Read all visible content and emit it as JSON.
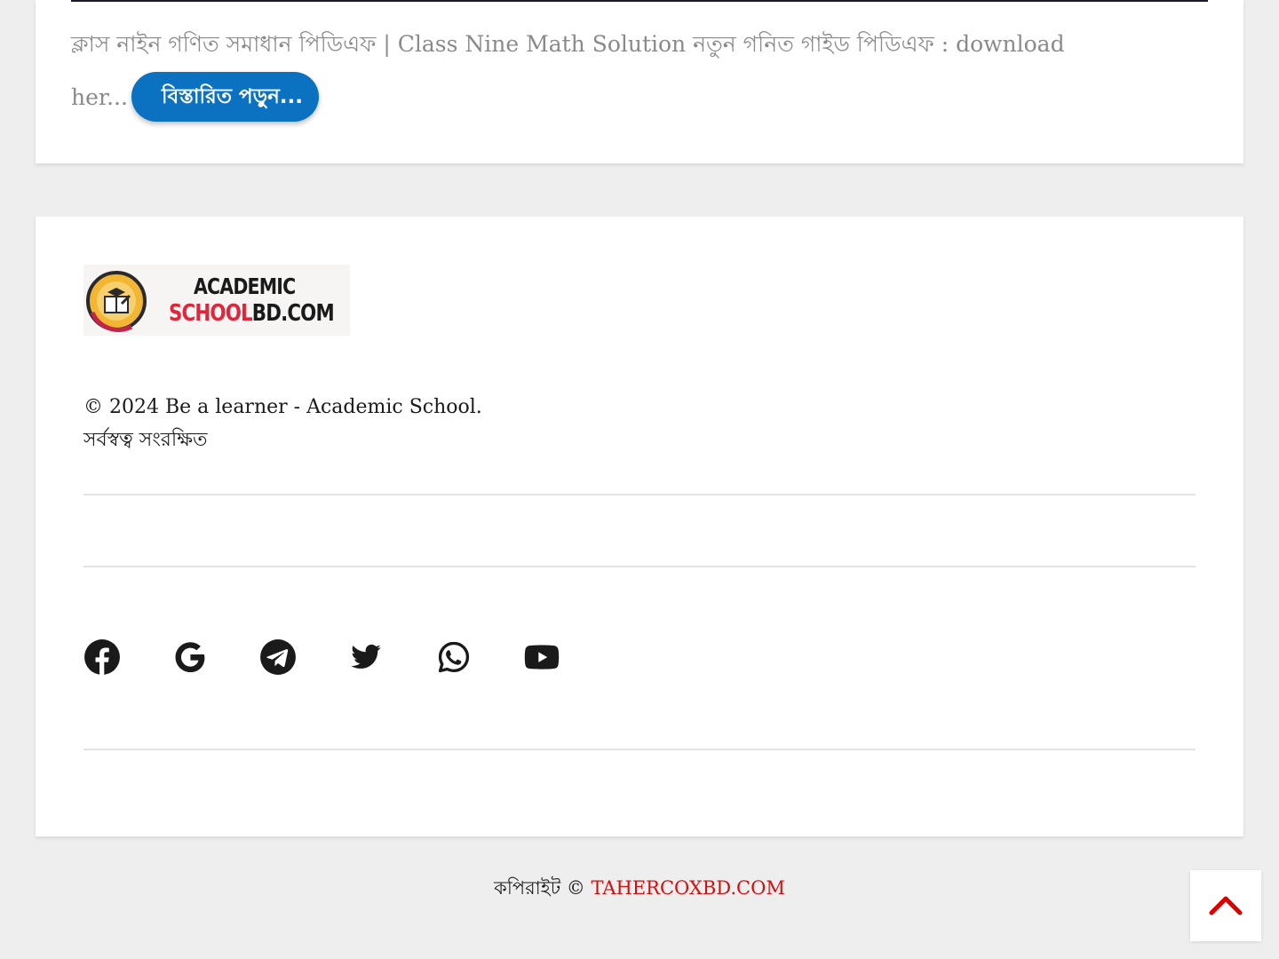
{
  "post": {
    "excerpt": "ক্লাস নাইন গণিত সমাধান পিডিএফ | Class Nine Math Solution নতুন গনিত গাইড পিডিএফ : download her...",
    "read_more_label": "বিস্তারিত পড়ুন..."
  },
  "footer": {
    "logo": {
      "line1": "ACADEMIC",
      "line2_red": "SCHOOL",
      "line2_dark": "BD.COM"
    },
    "copyright_line1": "© 2024 Be a learner - Academic School.",
    "copyright_line2": "সর্বস্বত্ব সংরক্ষিত",
    "social": [
      "facebook-icon",
      "google-icon",
      "telegram-icon",
      "twitter-icon",
      "whatsapp-icon",
      "youtube-icon"
    ]
  },
  "credit": {
    "prefix": "কপিরাইট ©",
    "site": "TAHERCOXBD.COM"
  },
  "colors": {
    "accent": "#0b72c2",
    "credit_link": "#cc1111",
    "back_to_top_arrow": "#dd0000",
    "page_bg": "#eeeeee"
  }
}
